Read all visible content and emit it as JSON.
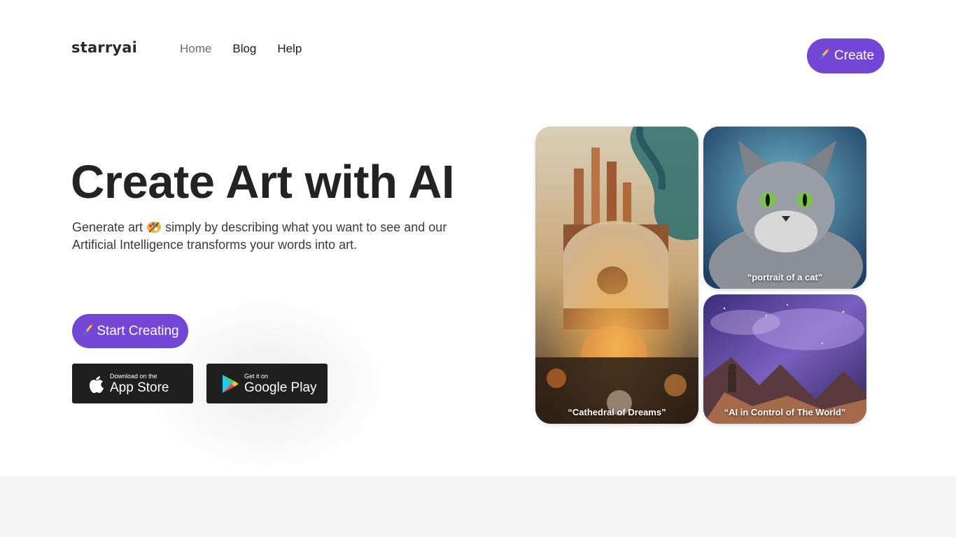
{
  "header": {
    "logo": "starryai",
    "nav": [
      {
        "label": "Home"
      },
      {
        "label": "Blog"
      },
      {
        "label": "Help"
      }
    ],
    "create_icon": "paintbrush-icon",
    "create_label": "Create"
  },
  "hero": {
    "title": "Create Art with AI",
    "description_part1": "Generate art",
    "palette_icon": "palette-icon",
    "description_part2": "simply by describing what you want to see and our Artificial Intelligence transforms your words into art.",
    "start_icon": "paintbrush-icon",
    "start_label": "Start Creating"
  },
  "stores": {
    "apple": {
      "small": "Download on the",
      "big": "App Store",
      "icon": "apple-icon"
    },
    "google": {
      "small": "Get it on",
      "big": "Google Play",
      "icon": "google-play-icon"
    }
  },
  "gallery": [
    {
      "caption": "“Cathedral of Dreams”"
    },
    {
      "caption": "“portrait of a cat”"
    },
    {
      "caption": "“AI in Control of The World”"
    }
  ],
  "colors": {
    "accent": "#7346d6",
    "store_bg": "#1f1f1f",
    "footer_band": "#f5f5f5"
  }
}
